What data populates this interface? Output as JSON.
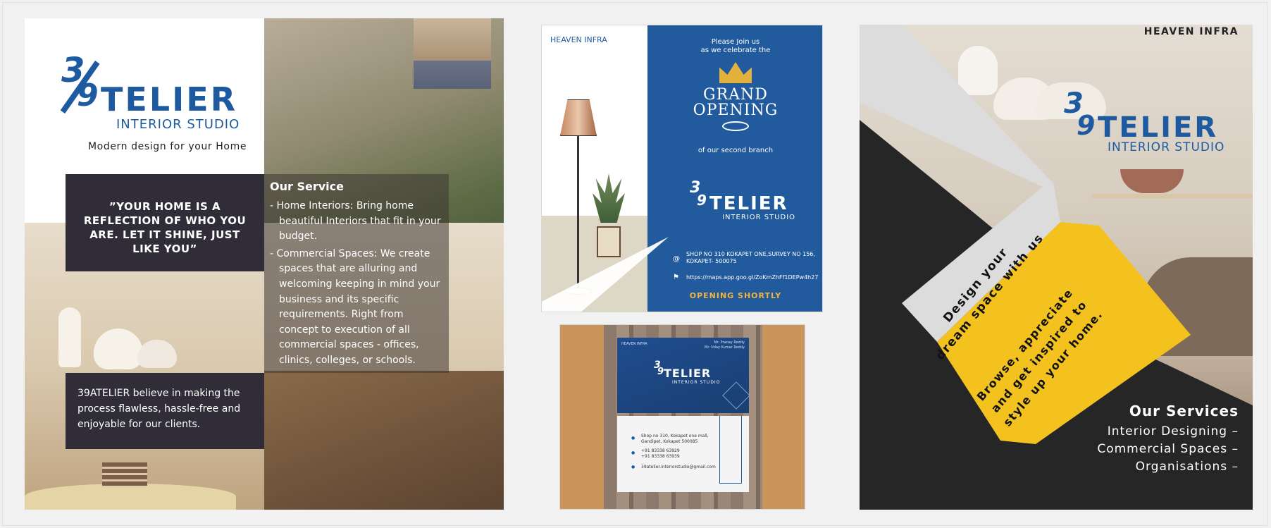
{
  "panel1": {
    "logo": {
      "num1": "3",
      "num2": "9",
      "word": "TELIER",
      "sub": "INTERIOR STUDIO"
    },
    "tagline": "Modern design for your Home",
    "quote": "”YOUR HOME IS A REFLECTION OF WHO YOU ARE. LET IT SHINE, JUST LIKE YOU”",
    "service_title": "Our Service",
    "services": [
      "- Home Interiors: Bring home beautiful Interiors that fit in your budget.",
      "-  Commercial Spaces: We create spaces that are alluring and welcoming keeping in mind your business and its specific requirements. Right from concept to execution of all commercial spaces - offices, clinics, colleges, or schools."
    ],
    "believe": "39ATELIER believe in making the process flawless, hassle-free and enjoyable for our clients."
  },
  "panel2": {
    "heaven": "HEAVEN INFRA",
    "join1": "Please Join us",
    "join2": "as we celebrate the",
    "grand": "GRAND",
    "opening": "OPENING",
    "second": "of our second branch",
    "logo": {
      "num1": "3",
      "num2": "9",
      "word": "TELIER",
      "sub": "INTERIOR STUDIO"
    },
    "address1": "SHOP NO 310 KOKAPET ONE,SURVEY NO 156,",
    "address2": "KOKAPET- 500075",
    "map_url": "https://maps.app.goo.gl/ZoKmZhFf1DEPw4h27",
    "shortly": "OPENING SHORTLY"
  },
  "panel3": {
    "front_heaven": "HEAVEN INFRA",
    "front_name1": "Mr. Pranay Reddy",
    "front_name2": "Mr. Uday Kumar Reddy",
    "logo": {
      "num1": "3",
      "num2": "9",
      "word": "TELIER",
      "sub": "INTERIOR STUDIO"
    },
    "back_addr1": "Shop no 310, Kokapet one mall,",
    "back_addr2": "Gandipet, Kokapet 500085",
    "back_phone1": "+91 83338 63929",
    "back_phone2": "+91 83338 63939",
    "back_email": "39atelier.interiorstudio@gmail.com"
  },
  "panel4": {
    "heaven": "HEAVEN INFRA",
    "logo": {
      "num1": "3",
      "num2": "9",
      "word": "TELIER",
      "sub": "INTERIOR STUDIO"
    },
    "design_line1": "Design your",
    "design_line2": "dream space with us",
    "browse_line1": "Browse, appreciate",
    "browse_line2": "and get inspired to",
    "browse_line3": "style up your home.",
    "services_title": "Our Services",
    "services": [
      "Interior Designing –",
      "Commercial Spaces –",
      "Organisations –"
    ]
  },
  "colors": {
    "brand_blue": "#1e5aa0",
    "dark_box": "#302d39",
    "gold": "#f2b43c",
    "yellow": "#f4c21e"
  }
}
